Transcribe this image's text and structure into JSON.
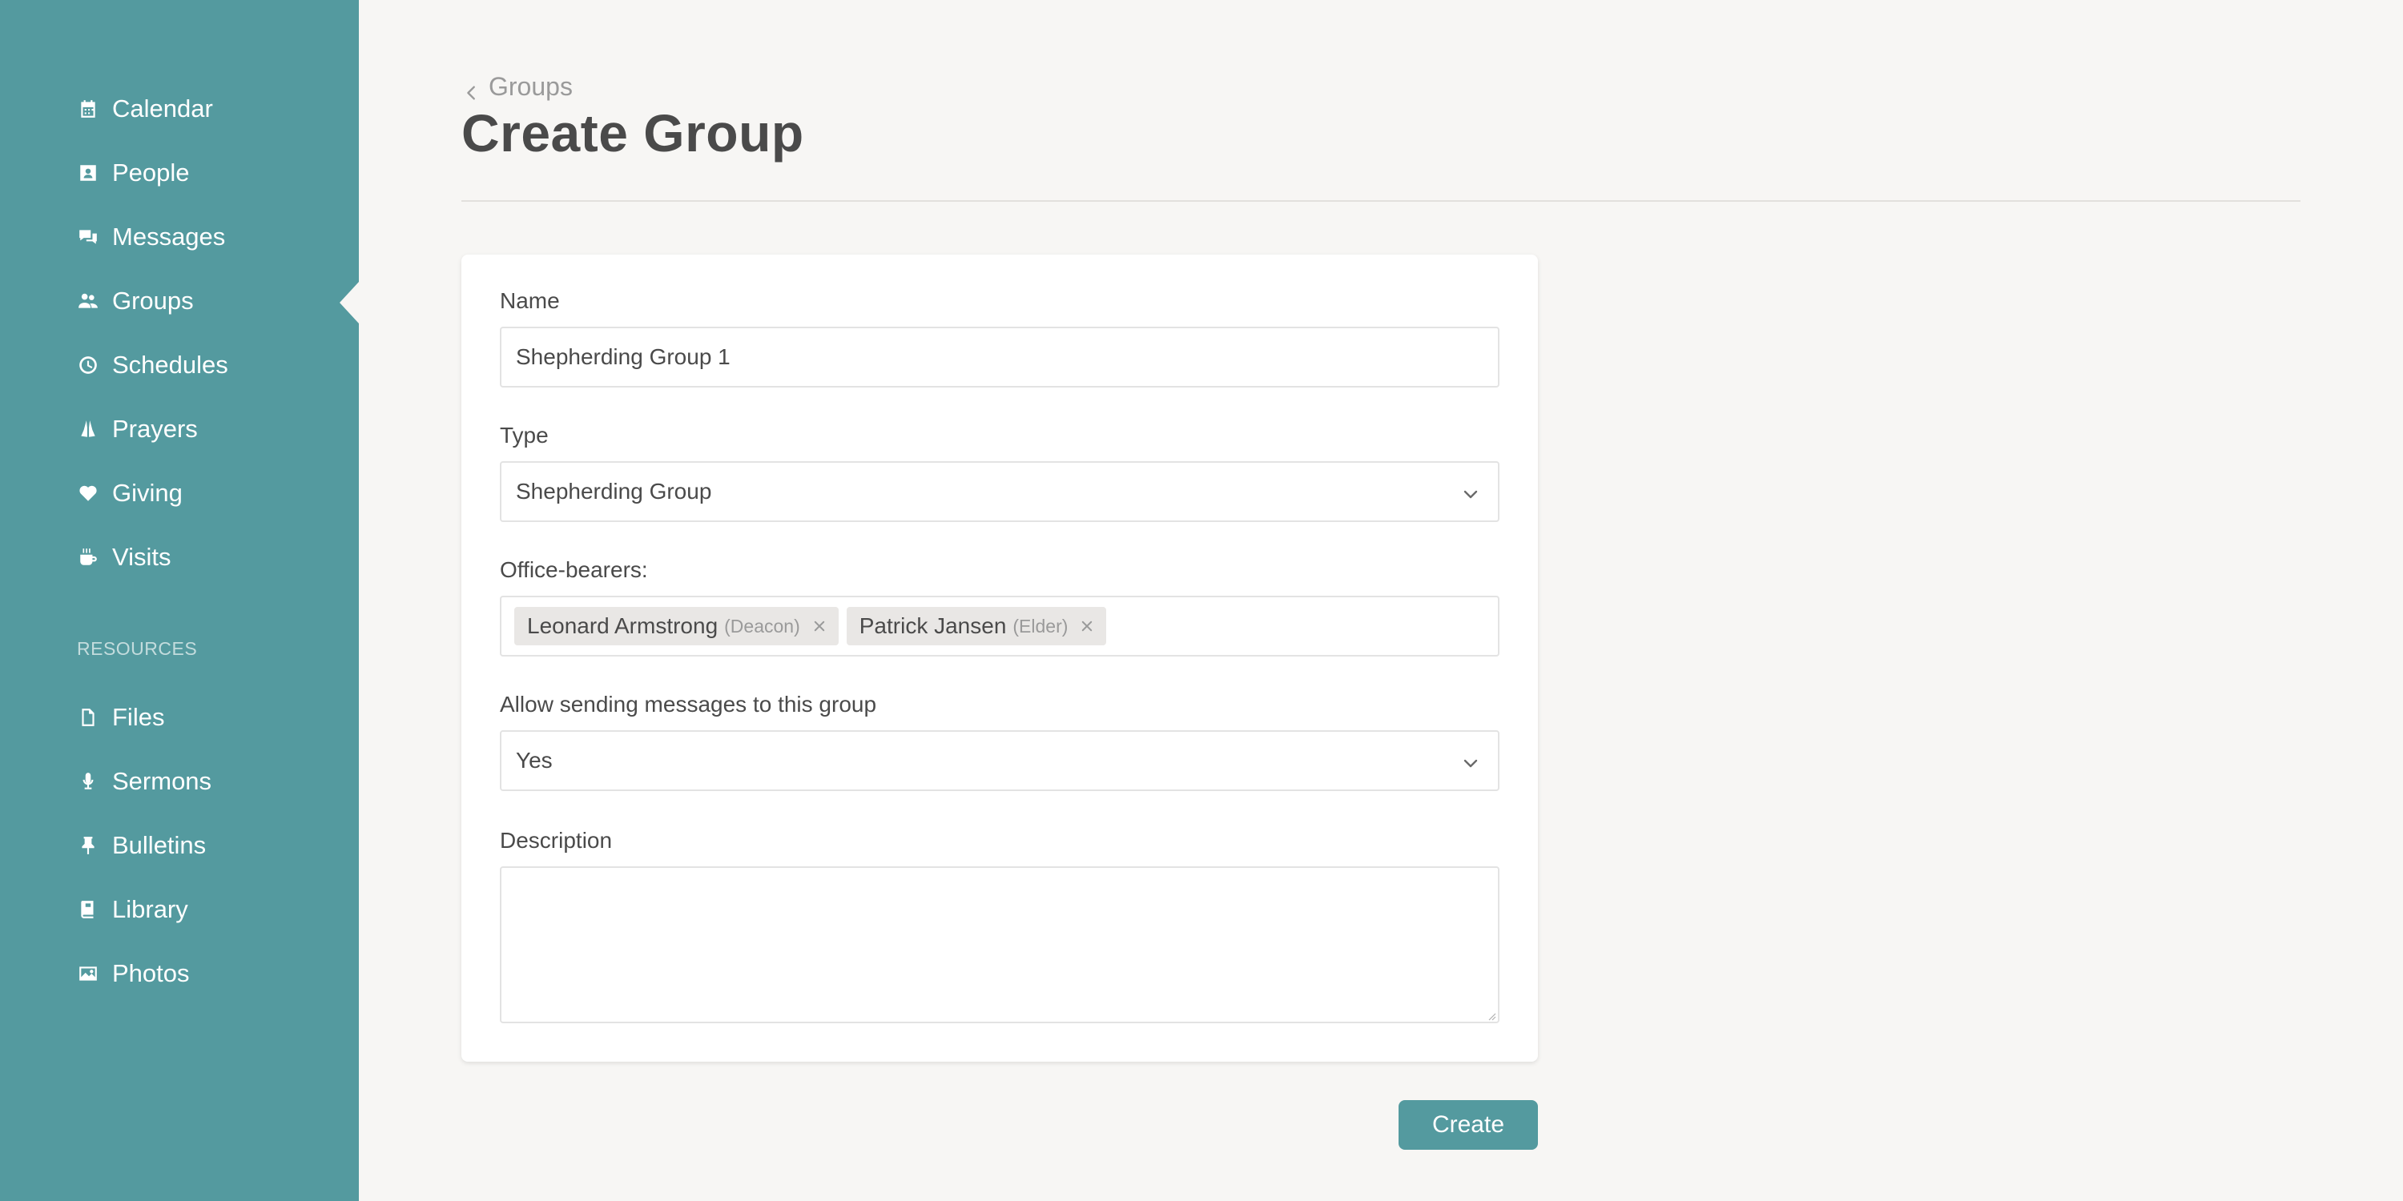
{
  "sidebar": {
    "items": [
      {
        "label": "Calendar",
        "icon": "calendar-icon"
      },
      {
        "label": "People",
        "icon": "contact-card-icon"
      },
      {
        "label": "Messages",
        "icon": "chat-bubbles-icon"
      },
      {
        "label": "Groups",
        "icon": "users-icon"
      },
      {
        "label": "Schedules",
        "icon": "clock-icon"
      },
      {
        "label": "Prayers",
        "icon": "praying-hands-icon"
      },
      {
        "label": "Giving",
        "icon": "heart-icon"
      },
      {
        "label": "Visits",
        "icon": "coffee-cup-icon"
      }
    ],
    "resources_heading": "RESOURCES",
    "resources": [
      {
        "label": "Files",
        "icon": "file-icon"
      },
      {
        "label": "Sermons",
        "icon": "microphone-icon"
      },
      {
        "label": "Bulletins",
        "icon": "pushpin-icon"
      },
      {
        "label": "Library",
        "icon": "book-icon"
      },
      {
        "label": "Photos",
        "icon": "image-icon"
      }
    ],
    "active_item": "Groups"
  },
  "header": {
    "breadcrumb": "Groups",
    "title": "Create Group"
  },
  "form": {
    "name": {
      "label": "Name",
      "value": "Shepherding Group 1"
    },
    "type": {
      "label": "Type",
      "value": "Shepherding Group"
    },
    "office_bearers": {
      "label": "Office-bearers:",
      "tags": [
        {
          "name": "Leonard Armstrong",
          "role": "(Deacon)"
        },
        {
          "name": "Patrick Jansen",
          "role": "(Elder)"
        }
      ]
    },
    "allow_messages": {
      "label": "Allow sending messages to this group",
      "value": "Yes"
    },
    "description": {
      "label": "Description",
      "value": ""
    }
  },
  "actions": {
    "create_label": "Create"
  },
  "colors": {
    "accent": "#549a9f",
    "background": "#f7f6f4",
    "card": "#ffffff"
  }
}
